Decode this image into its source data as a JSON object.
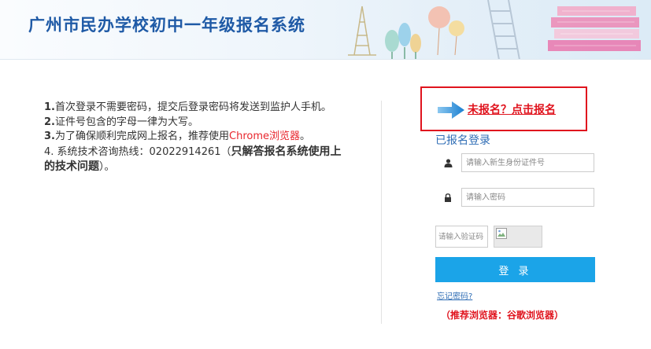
{
  "header": {
    "title": "广州市民办学校初中一年级报名系统"
  },
  "notice": {
    "line1_num": "1.",
    "line1_text": "首次登录不需要密码，提交后登录密码将发送到监护人手机。",
    "line2_num": "2.",
    "line2_text": "证件号包含的字母一律为大写。",
    "line3_num": "3.",
    "line3_text": "为了确保顺利完成网上报名，推荐使用",
    "line3_link": "Chrome浏览器",
    "line3_end": "。",
    "line4_text": "4. 系统技术咨询热线：02022914261（",
    "line4_bold": "只解答报名系统使用上的技术问题",
    "line4_end": "）。"
  },
  "register": {
    "link_label": "未报名？点击报名"
  },
  "login": {
    "heading": "已报名登录",
    "id_placeholder": "请输入新生身份证件号",
    "password_placeholder": "请输入密码",
    "captcha_placeholder": "请输入验证码",
    "submit_label": "登 录",
    "forgot_label": "忘记密码?",
    "browser_note": "（推荐浏览器：谷歌浏览器）"
  },
  "icons": {
    "user": "user-icon",
    "lock": "lock-icon",
    "arrow": "arrow-right-icon",
    "captcha": "broken-image-icon"
  },
  "colors": {
    "title_blue": "#1f5aa6",
    "link_blue": "#2f6db5",
    "accent_red": "#e0141e",
    "button_blue": "#1ba4e8"
  }
}
